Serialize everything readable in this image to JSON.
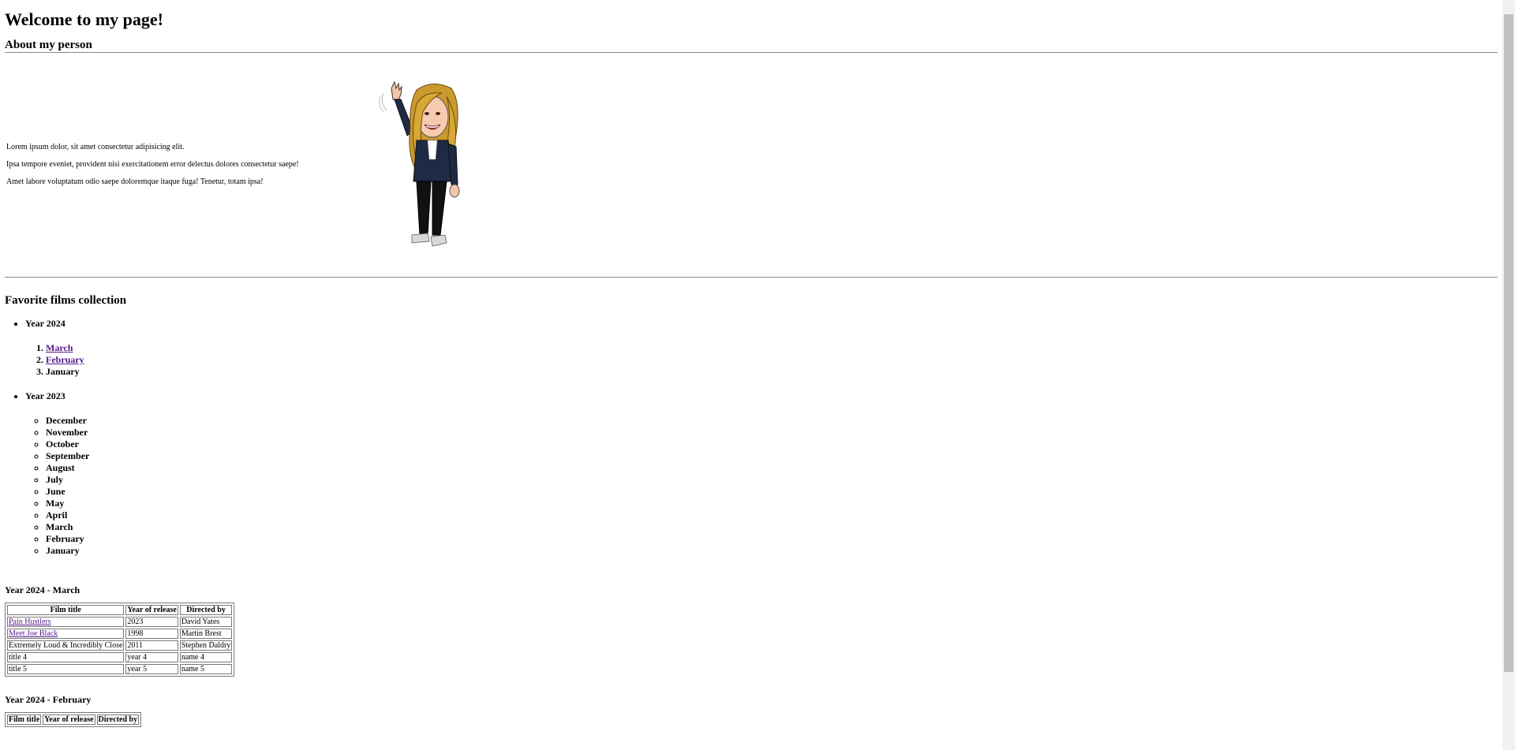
{
  "header": {
    "title": "Welcome to my page!",
    "about_title": "About my person"
  },
  "about": {
    "paragraphs": [
      "Lorem ipsum dolor, sit amet consectetur adipisicing elit.",
      "Ipsa tempore eveniet, provident nisi exercitationem error delectus dolores consectetur saepe!",
      "Amet labore voluptatum odio saepe doloremque itaque fuga! Tenetur, totam ipsa!"
    ]
  },
  "films": {
    "title": "Favorite films collection",
    "year_2024": {
      "label": "Year 2024",
      "months": [
        "March",
        "February",
        "January"
      ]
    },
    "year_2023": {
      "label": "Year 2023",
      "months": [
        "December",
        "November",
        "October",
        "September",
        "August",
        "July",
        "June",
        "May",
        "April",
        "March",
        "February",
        "January"
      ]
    }
  },
  "table_march": {
    "heading": "Year 2024 - March",
    "headers": [
      "Film title",
      "Year of release",
      "Directed by"
    ],
    "rows": [
      [
        "Pain Hustlers",
        "2023",
        "David Yates"
      ],
      [
        "Meet Joe Black",
        "1998",
        "Martin Brest"
      ],
      [
        "Extremely Loud & Incredibly Close",
        "2011",
        "Stephen Daldry"
      ],
      [
        "title 4",
        "year 4",
        "name 4"
      ],
      [
        "title 5",
        "year 5",
        "name 5"
      ]
    ]
  },
  "table_february": {
    "heading": "Year 2024 - February",
    "headers": [
      "Film title",
      "Year of release",
      "Directed by"
    ]
  },
  "colors": {
    "visited_link": "#551a8b",
    "rule": "#8a8a8a",
    "scrollbar_track": "#f1f1f1",
    "scrollbar_thumb": "#c1c1c1"
  }
}
